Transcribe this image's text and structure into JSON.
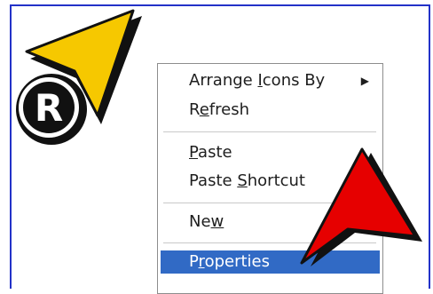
{
  "menu": {
    "items": [
      {
        "id": "arrange",
        "pre": "Arrange ",
        "u": "I",
        "post": "cons By",
        "has_submenu": true,
        "submenu_glyph": "▶"
      },
      {
        "id": "refresh",
        "pre": "R",
        "u": "e",
        "post": "fresh"
      },
      {
        "id": "paste",
        "pre": "",
        "u": "P",
        "post": "aste"
      },
      {
        "id": "paste-shortcut",
        "pre": "Paste ",
        "u": "S",
        "post": "hortcut"
      },
      {
        "id": "new",
        "pre": "Ne",
        "u": "w",
        "post": ""
      },
      {
        "id": "properties",
        "pre": "P",
        "u": "r",
        "post": "operties",
        "selected": true
      }
    ]
  },
  "badge": {
    "letter": "R"
  },
  "colors": {
    "frame_border": "#2332c8",
    "highlight": "#316ac5",
    "yellow_arrow": "#f6c800",
    "red_arrow": "#e60000"
  },
  "icons": {
    "top_left_arrow": "yellow-cursor-arrow-icon",
    "bottom_right_arrow": "red-cursor-arrow-icon",
    "badge": "registered-r-badge-icon",
    "submenu": "chevron-right-icon"
  }
}
